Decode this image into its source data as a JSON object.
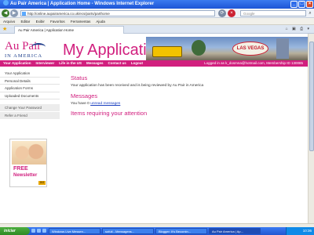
{
  "window": {
    "title": "Au Pair America | Application Home - Windows Internet Explorer",
    "min": "_",
    "max": "□",
    "close": "×"
  },
  "addressbar": {
    "url": "http://online.aupairamerica.co.uk/ecs/parts/parthome",
    "search_placeholder": "Google",
    "search_icon": "magnifier-icon"
  },
  "menubar": [
    "Arquivo",
    "Editar",
    "Exibir",
    "Favoritos",
    "Ferramentas",
    "Ajuda"
  ],
  "tab": {
    "label": "Au Pair America | Application Home"
  },
  "header": {
    "logo_main": "Au Pair",
    "logo_sub": "IN AMERICA",
    "app_title": "My Application",
    "banner_sign": "LAS VEGAS"
  },
  "nav": {
    "items": [
      "Your Application",
      "Interviewer",
      "Life in the US",
      "Messages",
      "Contact us",
      "Logout"
    ],
    "logged_in": "Logged in as k_dosmna@hotmail.com, Membership ID 130085"
  },
  "sidebar": {
    "items": [
      "Your Application",
      "Personal Details",
      "Application Forms",
      "Uploaded Documents"
    ],
    "secondary": [
      "Change Your Password",
      "Refer a Friend"
    ]
  },
  "ad": {
    "free": "FREE",
    "newsletter": "Newsletter",
    "go": "GO"
  },
  "main": {
    "status_heading": "Status",
    "status_text": "Your application has been received and is being reviewed by Au Pair in America",
    "messages_heading": "Messages",
    "messages_prefix": "You have 0",
    "messages_link": "unread messages",
    "items_heading": "Items requiring your attention"
  },
  "taskbar": {
    "start": "iniciar",
    "buttons": [
      "Windows Live Messen...",
      "sofuti - Mensagens...",
      "Blogger: It's Becomin...",
      "Au Pair America | Ap..."
    ],
    "clock": "10:36"
  },
  "colors": {
    "brand_pink": "#d11f7e",
    "brand_blue": "#1b3d8a",
    "link_blue": "#1a3fbf"
  }
}
